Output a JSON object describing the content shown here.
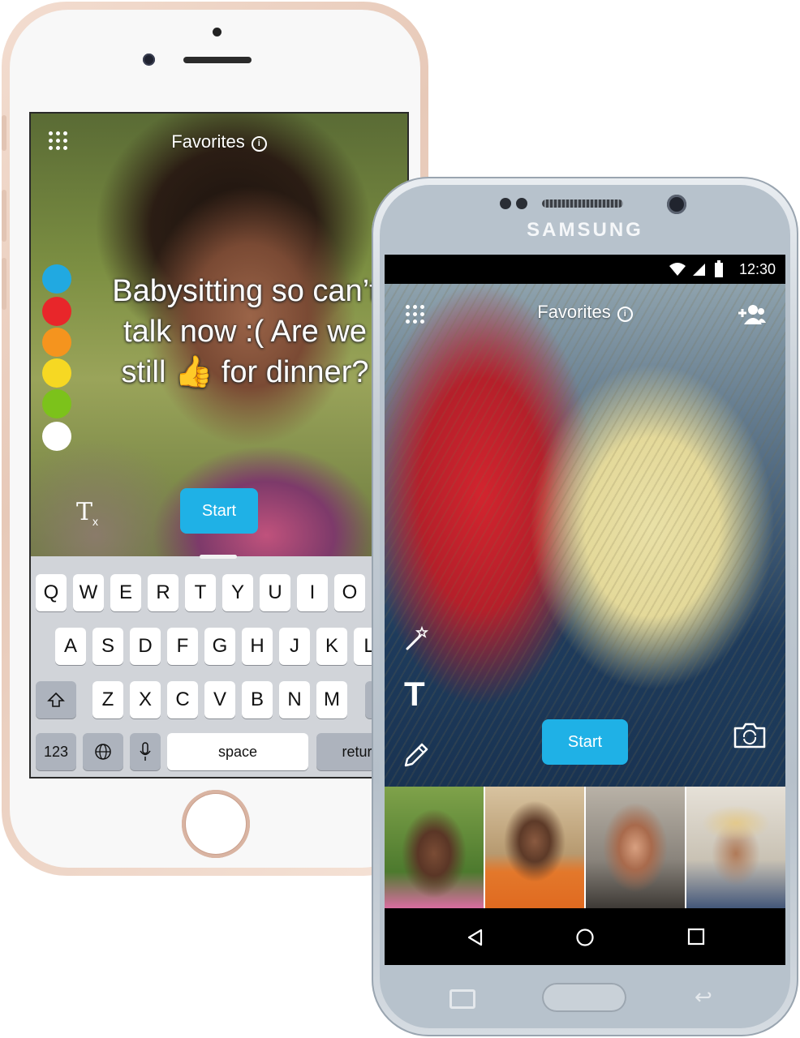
{
  "iphone": {
    "header": {
      "title": "Favorites",
      "grid_icon": "grid-menu-icon",
      "info_icon": "info-icon"
    },
    "colors": [
      "#21a9e1",
      "#e8262a",
      "#f5941e",
      "#f6d823",
      "#7cc21b",
      "#ffffff"
    ],
    "message": "Babysitting so can’t talk now :( Are we still 👍 for dinner?",
    "text_tool_label": "T",
    "text_tool_sub": "x",
    "start_label": "Start",
    "keyboard": {
      "row1": [
        "Q",
        "W",
        "E",
        "R",
        "T",
        "Y",
        "U",
        "I",
        "O"
      ],
      "row2": [
        "A",
        "S",
        "D",
        "F",
        "G",
        "H",
        "J",
        "K",
        "L"
      ],
      "row3": [
        "Z",
        "X",
        "C",
        "V",
        "B",
        "N",
        "M"
      ],
      "numbers_label": "123",
      "space_label": "space",
      "return_label": "return"
    }
  },
  "samsung": {
    "brand": "SAMSUNG",
    "status": {
      "time": "12:30"
    },
    "header": {
      "title": "Favorites"
    },
    "start_label": "Start",
    "thumbnails": [
      {
        "name": "Woman with curly hair outdoors",
        "colors": [
          "#6a8b3e",
          "#3a2a22"
        ]
      },
      {
        "name": "Woman in orange jacket",
        "colors": [
          "#e07a32",
          "#b99a73"
        ]
      },
      {
        "name": "Smiling man",
        "colors": [
          "#8e8a84",
          "#3e3a36"
        ]
      },
      {
        "name": "Woman in sun hat",
        "colors": [
          "#d4cdbf",
          "#6a7e9a"
        ]
      }
    ],
    "nav": [
      "back-icon",
      "home-icon",
      "recents-icon"
    ]
  }
}
